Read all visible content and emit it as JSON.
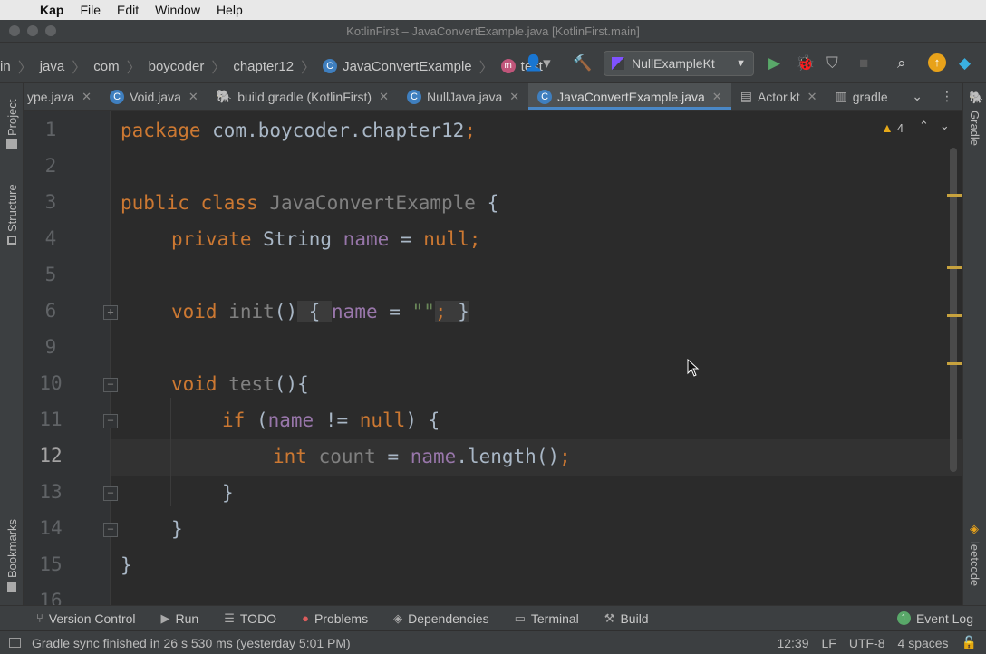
{
  "menubar": {
    "app": "Kap",
    "items": [
      "File",
      "Edit",
      "Window",
      "Help"
    ]
  },
  "window": {
    "title": "KotlinFirst – JavaConvertExample.java [KotlinFirst.main]"
  },
  "breadcrumbs": [
    "in",
    "java",
    "com",
    "boycoder",
    "chapter12",
    "JavaConvertExample",
    "test"
  ],
  "run_config": "NullExampleKt",
  "tabs": [
    {
      "label": "ype.java",
      "active": false
    },
    {
      "label": "Void.java",
      "active": false
    },
    {
      "label": "build.gradle (KotlinFirst)",
      "active": false
    },
    {
      "label": "NullJava.java",
      "active": false
    },
    {
      "label": "JavaConvertExample.java",
      "active": true
    },
    {
      "label": "Actor.kt",
      "active": false
    },
    {
      "label": "gradle",
      "active": false
    }
  ],
  "left_tools": [
    "Project",
    "Structure",
    "Bookmarks"
  ],
  "right_tools": [
    "Gradle",
    "leetcode"
  ],
  "editor": {
    "warning_count": "4",
    "line_numbers": [
      "1",
      "2",
      "3",
      "4",
      "5",
      "6",
      "9",
      "10",
      "11",
      "12",
      "13",
      "14",
      "15",
      "16"
    ],
    "current_line": "12",
    "lines": {
      "l1_a": "package",
      "l1_b": " com.boycoder.chapter12",
      "l1_c": ";",
      "l3_a": "public class",
      "l3_b": " JavaConvertExample",
      "l3_c": " {",
      "l4_a": "private",
      "l4_b": " String ",
      "l4_c": "name",
      "l4_d": " = ",
      "l4_e": "null",
      "l4_f": ";",
      "l6_a": "void",
      "l6_b": " init",
      "l6_c": "()",
      "l6_d": " { ",
      "l6_e": "name",
      "l6_f": " = ",
      "l6_g": "\"\"",
      "l6_h": ";",
      "l6_i": " }",
      "l10_a": "void",
      "l10_b": " test",
      "l10_c": "(){",
      "l11_a": "if",
      "l11_b": " (",
      "l11_c": "name",
      "l11_d": " != ",
      "l11_e": "null",
      "l11_f": ") {",
      "l12_a": "int",
      "l12_b": " count",
      "l12_c": " = ",
      "l12_d": "name",
      "l12_e": ".length()",
      "l12_f": ";",
      "l13": "}",
      "l14": "}",
      "l15": "}"
    }
  },
  "tool_windows": [
    "Version Control",
    "Run",
    "TODO",
    "Problems",
    "Dependencies",
    "Terminal",
    "Build",
    "Event Log"
  ],
  "status": {
    "message": "Gradle sync finished in 26 s 530 ms (yesterday 5:01 PM)",
    "position": "12:39",
    "line_sep": "LF",
    "encoding": "UTF-8",
    "indent": "4 spaces"
  },
  "colors": {
    "keyword": "#cc7832",
    "field": "#9876aa",
    "string": "#6a8759",
    "accent": "#4a88c7",
    "warning": "#e6a919"
  }
}
